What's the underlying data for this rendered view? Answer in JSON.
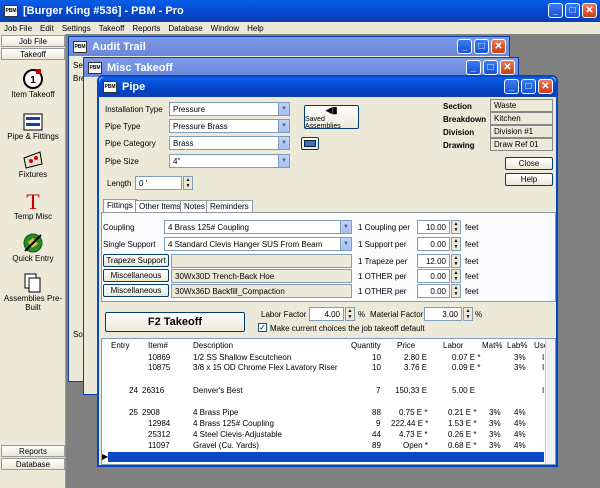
{
  "app": {
    "title": "[Burger King #536] - PBM - Pro"
  },
  "menu": [
    "Job File",
    "Edit",
    "Settings",
    "Takeoff",
    "Reports",
    "Database",
    "Window",
    "Help"
  ],
  "sidebar": {
    "top": [
      "Job File",
      "Takeoff"
    ],
    "items": [
      "Item Takeoff",
      "Pipe & Fittings",
      "Fixtures",
      "Temp Misc",
      "Quick Entry",
      "Assemblies Pre-Built"
    ],
    "bottom": [
      "Reports",
      "Database"
    ]
  },
  "windows": {
    "audit": "Audit Trail",
    "misc": "Misc Takeoff",
    "pipe": "Pipe"
  },
  "bg_fragments": {
    "sec": "Sec",
    "bre": "Bre",
    "so": "So"
  },
  "pipe": {
    "fields": [
      {
        "label": "Installation Type",
        "value": "Pressure"
      },
      {
        "label": "Pipe Type",
        "value": "Pressure Brass"
      },
      {
        "label": "Pipe Category",
        "value": "Brass"
      },
      {
        "label": "Pipe Size",
        "value": "4\""
      }
    ],
    "length_label": "Length",
    "length_value": "0  '",
    "saved_assemblies": "Saved Assemblies",
    "info": [
      {
        "label": "Section",
        "value": "Waste"
      },
      {
        "label": "Breakdown",
        "value": "Kitchen"
      },
      {
        "label": "Division",
        "value": "Division #1"
      },
      {
        "label": "Drawing",
        "value": "Draw Ref 01"
      }
    ],
    "close": "Close",
    "help": "Help",
    "tabs": [
      "Fittings",
      "Other Items",
      "Notes",
      "Reminders"
    ],
    "fittings": [
      {
        "label": "Coupling",
        "value": "4 Brass 125# Coupling",
        "per": "1 Coupling per",
        "num": "10.00",
        "unit": "feet"
      },
      {
        "label": "Single Support",
        "value": "4 Standard Clevis Hanger SUS From Beam",
        "per": "1 Support per",
        "num": "0.00",
        "unit": "feet"
      },
      {
        "label": "Trapeze Support",
        "value": "",
        "per": "1 Trapeze per",
        "num": "12.00",
        "unit": "feet"
      },
      {
        "label": "Miscellaneous",
        "value": "30Wx30D Trench-Back Hoe",
        "per": "1 OTHER per",
        "num": "0.00",
        "unit": "feet"
      },
      {
        "label": "Miscellaneous",
        "value": "30Wx36D Backfill_Compaction",
        "per": "1 OTHER per",
        "num": "0.00",
        "unit": "feet"
      }
    ],
    "f2": "F2 Takeoff",
    "labor_factor_label": "Labor Factor",
    "labor_factor": "4.00",
    "pct": "%",
    "material_factor_label": "Material Factor",
    "material_factor": "3.00",
    "default_check": "Make current choices the job takeoff default",
    "table_headers": [
      "Entry",
      "Item#",
      "Description",
      "Quantity",
      "Price",
      "Labor",
      "Mat%",
      "Lab%",
      "Use"
    ],
    "rows": [
      {
        "entry": "",
        "item": "10869",
        "desc": "1/2 SS Shallow Escutcheon",
        "qty": "10",
        "price": "2.80 E",
        "labor": "0.07 E *",
        "mat": "",
        "lab": "3%",
        "use": "I"
      },
      {
        "entry": "",
        "item": "10875",
        "desc": "3/8 x 15 OD Chrome Flex Lavatory Riser",
        "qty": "10",
        "price": "3.76 E",
        "labor": "0.09 E *",
        "mat": "",
        "lab": "3%",
        "use": "I"
      },
      {
        "entry": "24",
        "item": "26316",
        "desc": "Denver's Best",
        "qty": "7",
        "price": "150.33 E",
        "labor": "5.00 E",
        "mat": "",
        "lab": "",
        "use": "I"
      },
      {
        "entry": "25",
        "item": "2908",
        "desc": "4 Brass Pipe",
        "qty": "88",
        "price": "0.75 E *",
        "labor": "0.21 E *",
        "mat": "3%",
        "lab": "4%",
        "use": ""
      },
      {
        "entry": "",
        "item": "12984",
        "desc": "4 Brass 125# Coupling",
        "qty": "9",
        "price": "222.44 E *",
        "labor": "1.53 E *",
        "mat": "3%",
        "lab": "4%",
        "use": ""
      },
      {
        "entry": "",
        "item": "25312",
        "desc": "4 Steel Clevis-Adjustable",
        "qty": "44",
        "price": "4.73 E *",
        "labor": "0.26 E *",
        "mat": "3%",
        "lab": "4%",
        "use": ""
      },
      {
        "entry": "",
        "item": "11097",
        "desc": "Gravel (Cu. Yards)",
        "qty": "89",
        "price": "Open *",
        "labor": "0.68 E *",
        "mat": "3%",
        "lab": "4%",
        "use": ""
      }
    ]
  },
  "colors": {
    "titlebar": "#0446c8",
    "selected_row": "#0a46c8",
    "face": "#ece9d8"
  }
}
